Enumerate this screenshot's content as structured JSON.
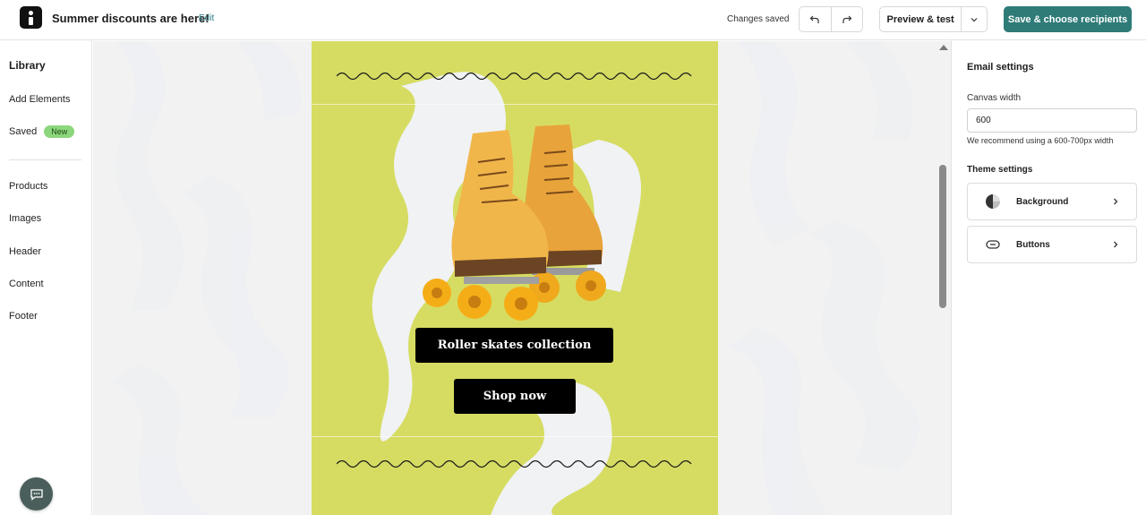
{
  "header": {
    "campaign_title": "Summer discounts are here!",
    "edit_label": "Edit",
    "status": "Changes saved",
    "preview_label": "Preview & test",
    "save_label": "Save & choose recipients",
    "accent_color": "#2e7b78"
  },
  "sidebar": {
    "title": "Library",
    "items": [
      {
        "label": "Add Elements"
      },
      {
        "label": "Saved",
        "badge": "New"
      },
      {
        "label": "Products"
      },
      {
        "label": "Images"
      },
      {
        "label": "Header"
      },
      {
        "label": "Content"
      },
      {
        "label": "Footer"
      }
    ]
  },
  "email": {
    "background_color": "#d6dc62",
    "collection_button": "Roller skates collection",
    "shop_button": "Shop now"
  },
  "settings": {
    "title": "Email settings",
    "canvas_width_label": "Canvas width",
    "canvas_width_value": "600",
    "canvas_width_hint": "We recommend using a 600-700px width",
    "theme_title": "Theme settings",
    "cards": [
      {
        "label": "Background",
        "icon": "half-circle-icon"
      },
      {
        "label": "Buttons",
        "icon": "pill-button-icon"
      }
    ]
  }
}
